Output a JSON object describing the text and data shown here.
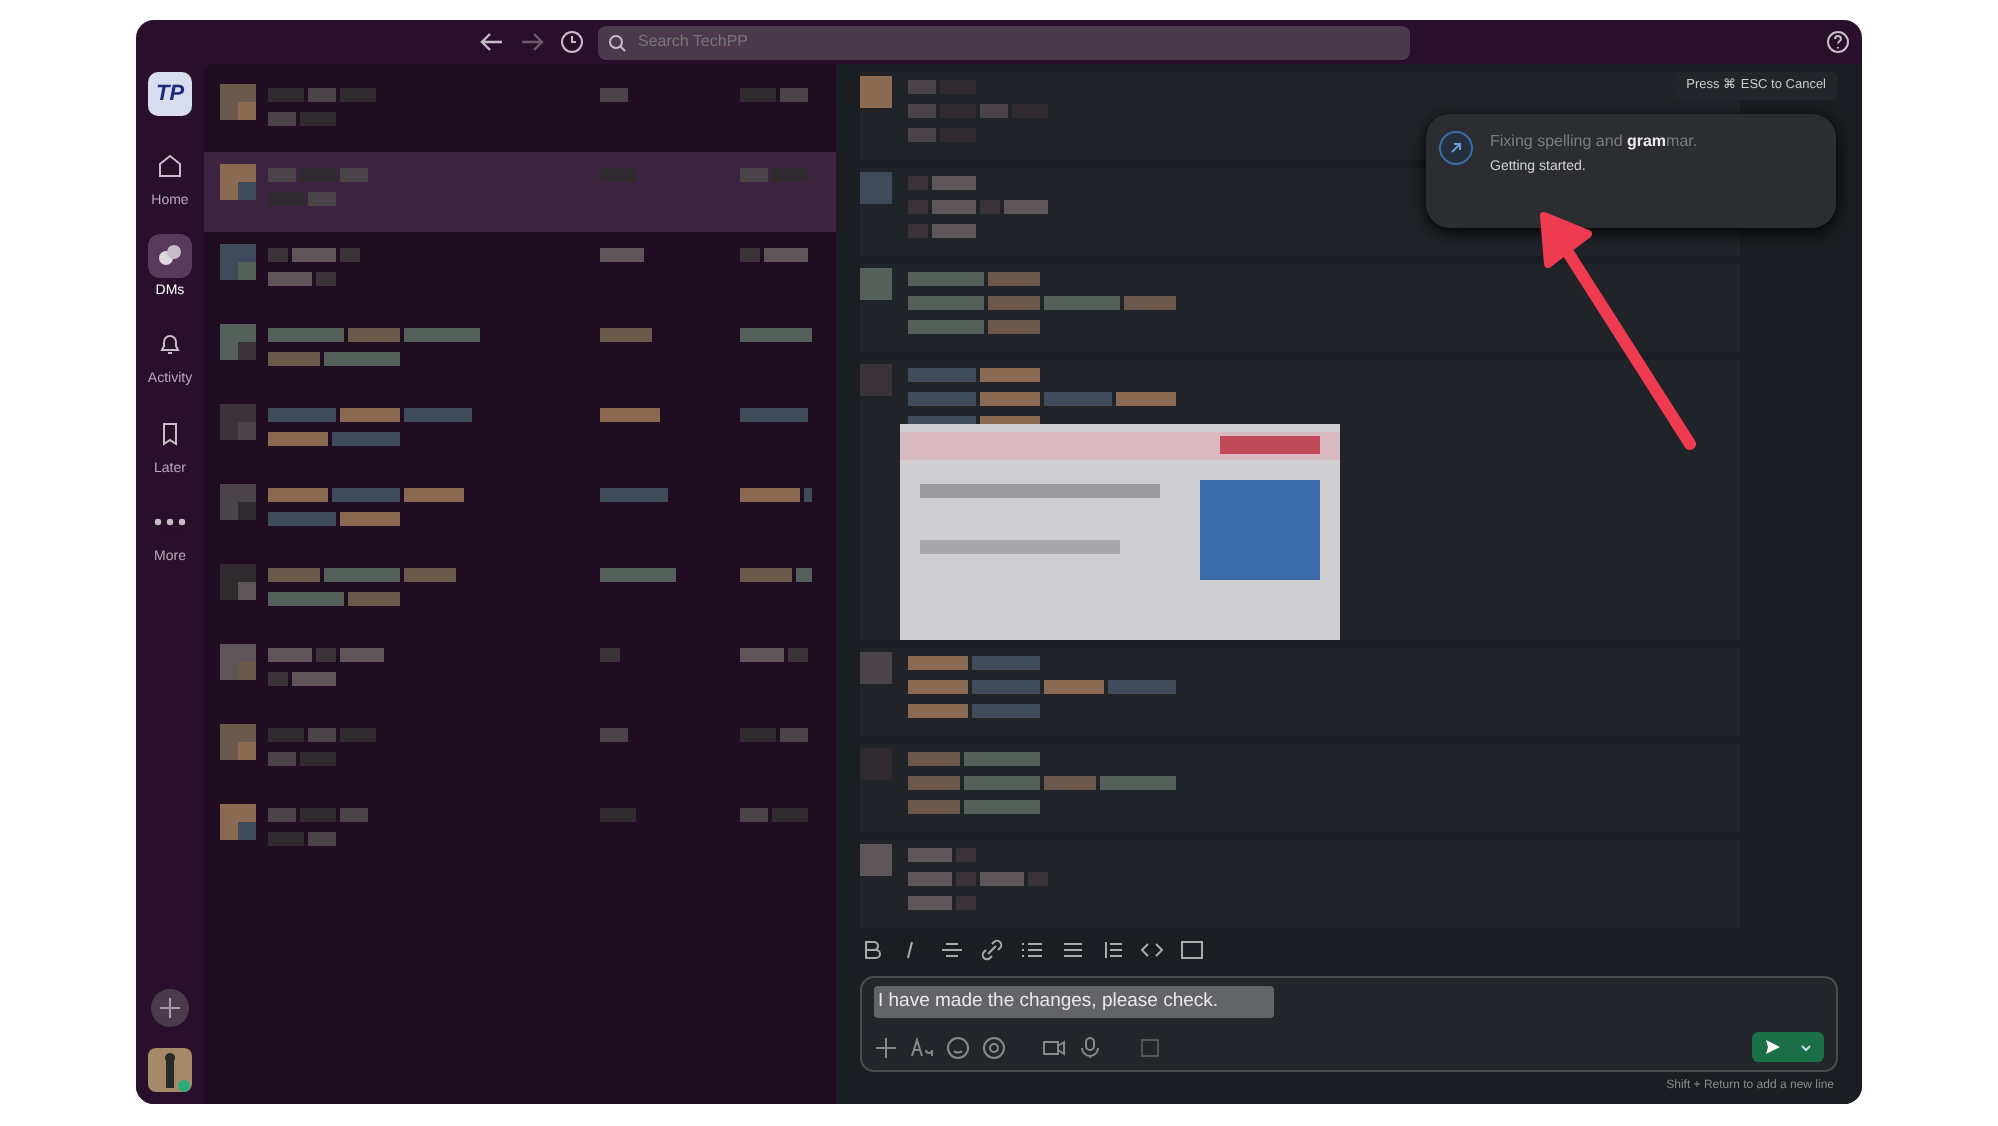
{
  "toolbar": {
    "search_placeholder": "Search TechPP"
  },
  "rail": {
    "logo": "TP",
    "items": [
      {
        "label": "Home",
        "selected": false
      },
      {
        "label": "DMs",
        "selected": true
      },
      {
        "label": "Activity",
        "selected": false
      },
      {
        "label": "Later",
        "selected": false
      },
      {
        "label": "More",
        "selected": false
      }
    ]
  },
  "dm_list": [
    {
      "kind": "picture",
      "selected": false
    },
    {
      "kind": "picture",
      "selected": true
    },
    {
      "kind": "picture",
      "selected": false
    },
    {
      "kind": "picture",
      "selected": false
    },
    {
      "kind": "picture",
      "selected": false
    },
    {
      "kind": "picture",
      "selected": false
    },
    {
      "kind": "picture",
      "selected": false
    },
    {
      "kind": "picture",
      "selected": false
    },
    {
      "kind": "picture",
      "selected": false
    },
    {
      "kind": "picture",
      "selected": false
    }
  ],
  "messages": [
    {
      "kind": "picture"
    },
    {
      "kind": "picture"
    },
    {
      "kind": "picture"
    },
    {
      "kind": "picture"
    },
    {
      "kind": "picture"
    },
    {
      "kind": "picture"
    },
    {
      "kind": "picture"
    }
  ],
  "cancel_hint": "Press ⌘ ESC to Cancel",
  "ai_popup": {
    "title_prefix": "Fixing spelling and ",
    "title_emphasis": "gram",
    "title_suffix": "mar.",
    "status": "Getting started."
  },
  "composer": {
    "value": "I have made the changes, please check.",
    "hint": "Shift + Return to add a new line"
  }
}
